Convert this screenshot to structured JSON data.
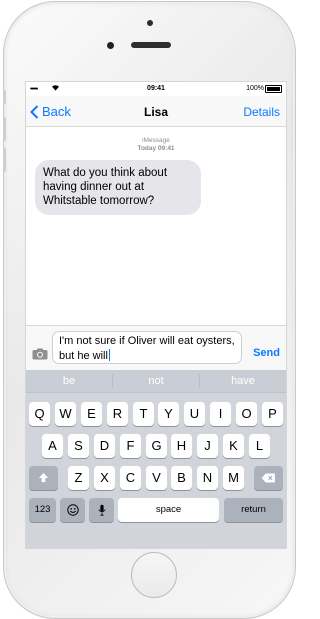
{
  "status_bar": {
    "signal": "•••••",
    "time": "09:41",
    "battery": "100%"
  },
  "nav": {
    "back_label": "Back",
    "title": "Lisa",
    "details_label": "Details"
  },
  "conversation": {
    "service": "iMessage",
    "timestamp": "Today 09:41",
    "messages": [
      {
        "from": "Lisa",
        "text": "What do you think about having dinner out at Whitstable tomorrow?"
      }
    ]
  },
  "composer": {
    "draft": "I'm not sure if Oliver will eat oysters, but he will",
    "send_label": "Send"
  },
  "keyboard": {
    "predictions": [
      "be",
      "not",
      "have"
    ],
    "row1": [
      "Q",
      "W",
      "E",
      "R",
      "T",
      "Y",
      "U",
      "I",
      "O",
      "P"
    ],
    "row2": [
      "A",
      "S",
      "D",
      "F",
      "G",
      "H",
      "J",
      "K",
      "L"
    ],
    "row3": [
      "Z",
      "X",
      "C",
      "V",
      "B",
      "N",
      "M"
    ],
    "numbers_label": "123",
    "space_label": "space",
    "return_label": "return"
  },
  "colors": {
    "accent": "#0a7aff",
    "incoming_bubble": "#e5e5ea",
    "keyboard_bg": "#d1d5db"
  }
}
